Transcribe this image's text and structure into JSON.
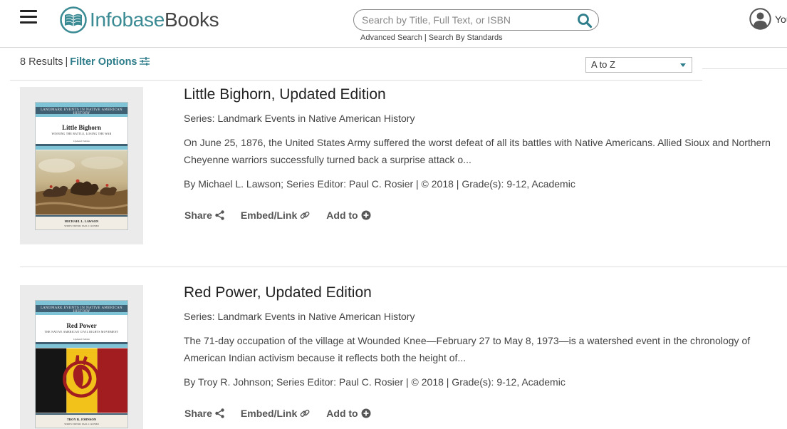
{
  "header": {
    "logo": {
      "part1": "Infobase",
      "part2": "Books"
    },
    "search": {
      "placeholder": "Search by Title, Full Text, or ISBN"
    },
    "links": {
      "advanced": "Advanced Search",
      "standards": "Search By Standards"
    },
    "user_label": "You"
  },
  "toolbar": {
    "results": "8 Results",
    "filter": "Filter Options",
    "sort_value": "A to Z"
  },
  "action_labels": {
    "share": "Share",
    "embed": "Embed/Link",
    "add": "Add to"
  },
  "results": [
    {
      "title": "Little Bighorn, Updated Edition",
      "series": "Series: Landmark Events in Native American History",
      "desc_line1": "On June 25, 1876, the United States Army suffered the worst defeat of all its battles with Native Americans. Allied Sioux and Northern",
      "desc_line2": "Cheyenne warriors successfully turned back a surprise attack o...",
      "meta": "By Michael L. Lawson; Series Editor: Paul C. Rosier | © 2018 | Grade(s): 9-12, Academic",
      "cover": {
        "series": "LANDMARK EVENTS IN NATIVE AMERICAN HISTORY",
        "title": "Little Bighorn",
        "subtitle": "WINNING THE BATTLE, LOSING THE WAR",
        "edition": "Updated Edition",
        "author": "MICHAEL L. LAWSON",
        "editor": "SERIES EDITOR: PAUL C. ROSIER"
      }
    },
    {
      "title": "Red Power, Updated Edition",
      "series": "Series: Landmark Events in Native American History",
      "desc_line1": "The 71-day occupation of the village at Wounded Knee—February 27 to May 8, 1973—is a watershed event in the chronology of",
      "desc_line2": "American Indian activism because it reflects both the height of...",
      "meta": "By Troy R. Johnson; Series Editor: Paul C. Rosier | © 2018 | Grade(s): 9-12, Academic",
      "cover": {
        "series": "LANDMARK EVENTS IN NATIVE AMERICAN HISTORY",
        "title": "Red Power",
        "subtitle": "THE NATIVE AMERICAN CIVIL RIGHTS MOVEMENT",
        "edition": "Updated Edition",
        "author": "TROY R. JOHNSON",
        "editor": "SERIES EDITOR: PAUL C. ROSIER"
      }
    }
  ],
  "colors": {
    "accent": "#2e7d8a",
    "cover_band": "#3f5f73",
    "cover_teal": "#7fc4d6",
    "red": "#a21d1f",
    "yellow": "#f2c21b"
  }
}
